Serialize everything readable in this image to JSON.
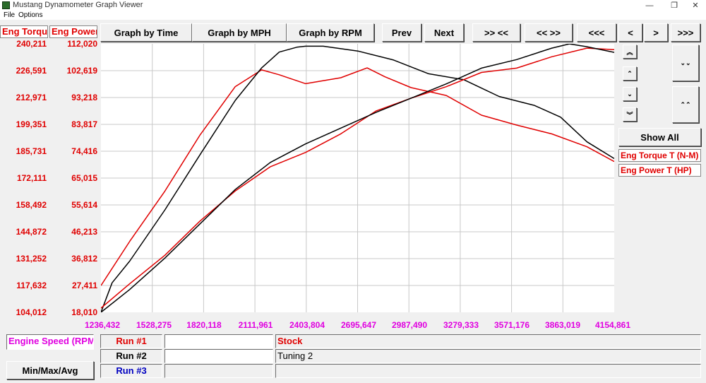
{
  "window": {
    "title": "Mustang Dynamometer Graph Viewer"
  },
  "menu": {
    "items": [
      "File",
      "Options"
    ]
  },
  "toolbar": {
    "graph_time": "Graph by Time",
    "graph_mph": "Graph by MPH",
    "graph_rpm": "Graph by RPM",
    "prev": "Prev",
    "next": "Next",
    "zoom_in": ">> <<",
    "zoom_out": "<< >>",
    "first": "<<<",
    "back": "<",
    "forward": ">",
    "last": ">>>"
  },
  "axes": {
    "left_header": "Eng Torque T (N-M)",
    "right_header": "Eng Power T (HP)",
    "torque_ticks": [
      "240,211",
      "226,591",
      "212,971",
      "199,351",
      "185,731",
      "172,111",
      "158,492",
      "144,872",
      "131,252",
      "117,632",
      "104,012"
    ],
    "power_ticks": [
      "112,020",
      "102,619",
      "93,218",
      "83,817",
      "74,416",
      "65,015",
      "55,614",
      "46,213",
      "36,812",
      "27,411",
      "18,010"
    ],
    "x_ticks": [
      "1236,432",
      "1528,275",
      "1820,118",
      "2111,961",
      "2403,804",
      "2695,647",
      "2987,490",
      "3279,333",
      "3571,176",
      "3863,019",
      "4154,861"
    ],
    "x_label": "Engine Speed (RPM)"
  },
  "side": {
    "scroll_up_fast": "︽",
    "scroll_up": "⌃",
    "scroll_down": "⌄",
    "scroll_down_fast": "︾",
    "expand": "⌄⌄",
    "collapse": "⌃⌃",
    "show_all": "Show All",
    "legend": [
      "Eng Torque T (N-M)",
      "Eng Power T (HP)"
    ]
  },
  "bottom": {
    "minmax": "Min/Max/Avg",
    "runs": [
      {
        "label": "Run #1",
        "name": "Stock"
      },
      {
        "label": "Run #2",
        "name": "Tuning 2"
      },
      {
        "label": "Run #3",
        "name": ""
      }
    ]
  },
  "colors": {
    "run1": "#e00000",
    "run2": "#000000",
    "run3": "#0000c0",
    "torque": "#e00000",
    "xaxis": "#e000e0",
    "grid": "#c8c8c8"
  },
  "chart_data": {
    "type": "line",
    "xlabel": "Engine Speed (RPM)",
    "xlim": [
      1236.432,
      4154.861
    ],
    "ylim_torque": [
      104.012,
      240.211
    ],
    "ylim_power": [
      18.01,
      112.02
    ],
    "series": [
      {
        "name": "Stock",
        "color": "#e00000",
        "axis": "torque",
        "x": [
          1236.4,
          1400,
          1600,
          1800,
          2000,
          2150,
          2250,
          2400,
          2600,
          2750,
          2850,
          3000,
          3200,
          3400,
          3600,
          3800,
          4000,
          4154.9
        ],
        "y": [
          117.6,
          140.0,
          165.5,
          194.0,
          218.5,
          227.0,
          224.5,
          220.0,
          223.0,
          228.0,
          223.5,
          218.0,
          214.0,
          204.0,
          199.0,
          194.5,
          188.0,
          180.5
        ]
      },
      {
        "name": "Tuning 2",
        "color": "#000000",
        "axis": "torque",
        "x": [
          1236.4,
          1300,
          1400,
          1600,
          1800,
          2000,
          2150,
          2250,
          2350,
          2400,
          2500,
          2700,
          2900,
          3100,
          3300,
          3500,
          3700,
          3850,
          4000,
          4154.9
        ],
        "y": [
          104.0,
          119.0,
          130.0,
          156.0,
          184.0,
          211.5,
          228.0,
          236.0,
          238.5,
          239.0,
          239.0,
          236.5,
          232.0,
          225.0,
          222.0,
          213.5,
          209.0,
          203.0,
          190.5,
          182.0
        ]
      },
      {
        "name": "Stock",
        "color": "#e00000",
        "axis": "power",
        "x": [
          1236.4,
          1400,
          1600,
          1800,
          2000,
          2200,
          2400,
          2600,
          2800,
          3000,
          3200,
          3400,
          3600,
          3800,
          4000,
          4154.9
        ],
        "y": [
          19.5,
          28.0,
          38.0,
          50.0,
          60.5,
          69.0,
          74.0,
          80.5,
          88.5,
          93.0,
          97.0,
          102.0,
          103.5,
          107.5,
          110.5,
          110.0
        ]
      },
      {
        "name": "Tuning 2",
        "color": "#000000",
        "axis": "power",
        "x": [
          1236.4,
          1400,
          1600,
          1800,
          2000,
          2200,
          2400,
          2600,
          2800,
          3000,
          3200,
          3400,
          3600,
          3800,
          3900,
          4000,
          4154.9
        ],
        "y": [
          18.0,
          26.0,
          37.0,
          49.0,
          61.0,
          70.5,
          77.0,
          82.5,
          88.0,
          93.0,
          98.0,
          103.5,
          106.5,
          110.5,
          112.0,
          111.0,
          109.0
        ]
      }
    ]
  }
}
